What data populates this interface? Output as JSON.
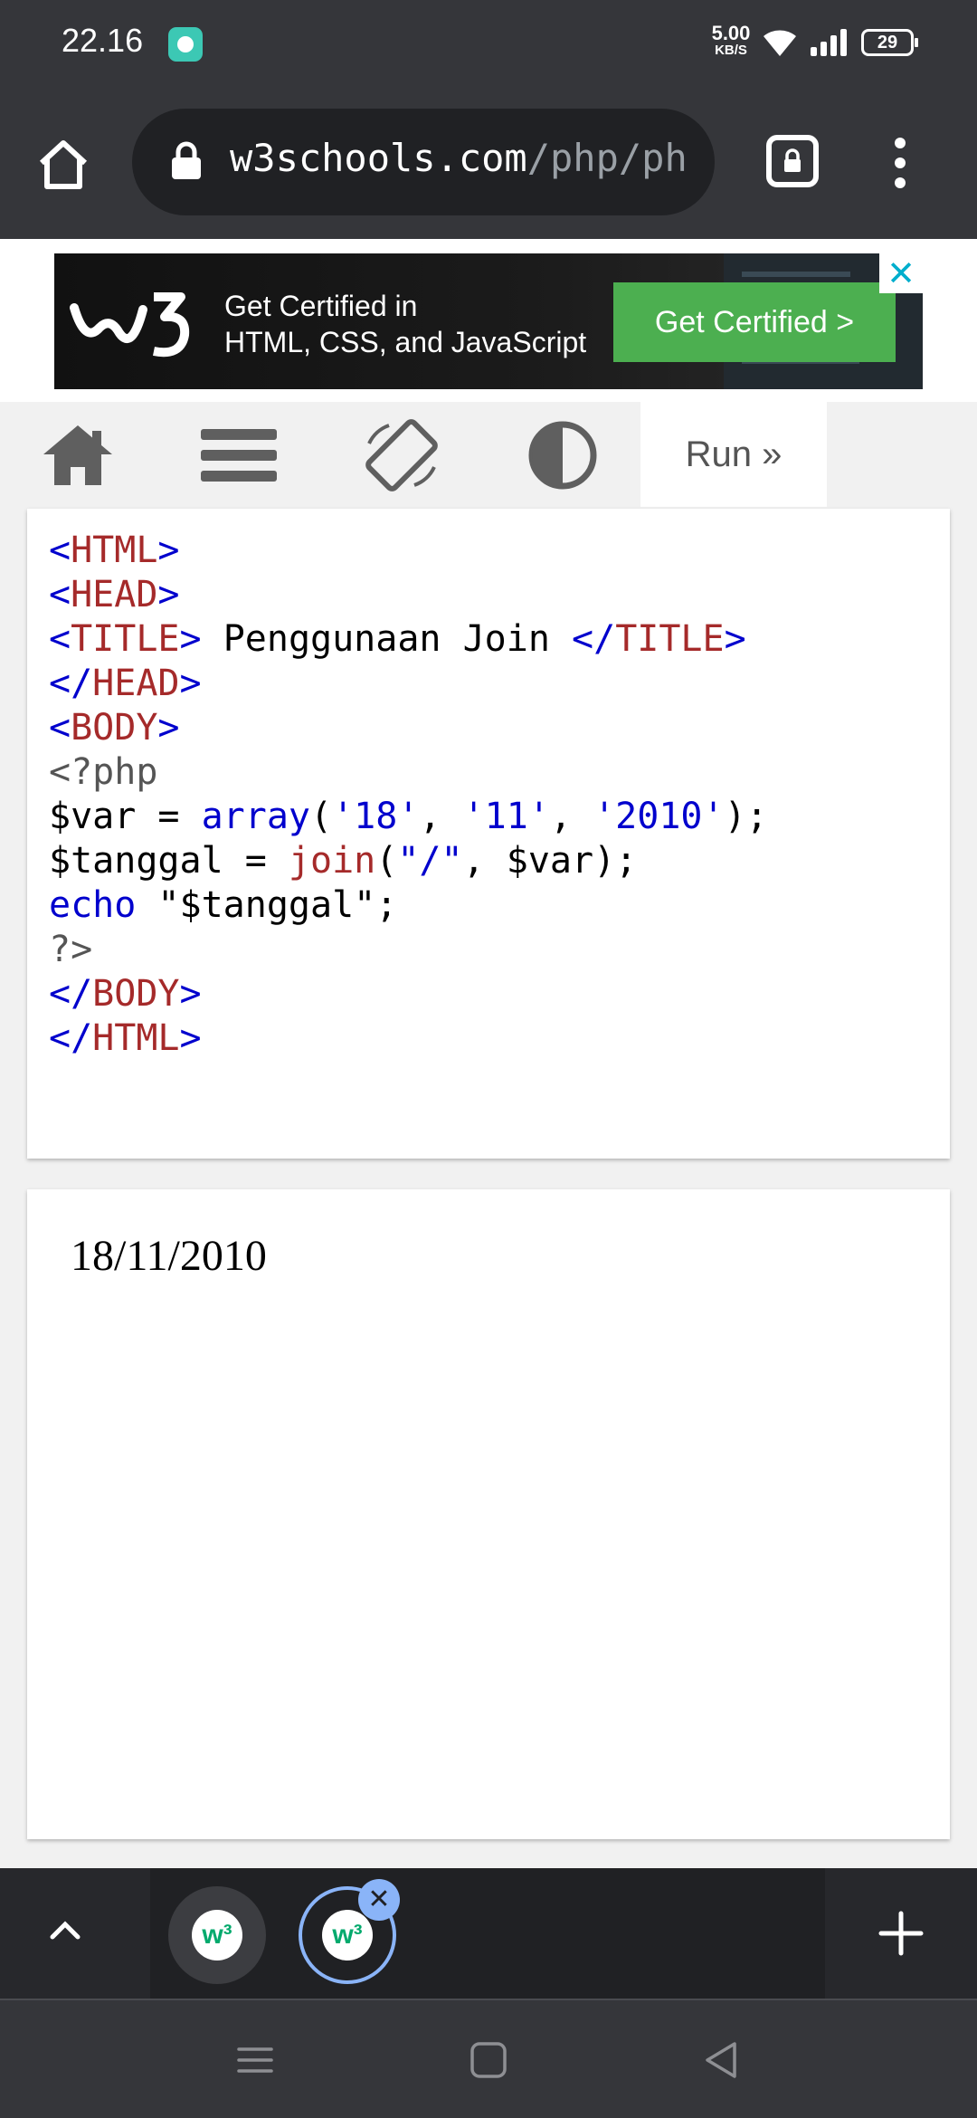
{
  "status_bar": {
    "time": "22.16",
    "net_speed_value": "5.00",
    "net_speed_unit": "KB/S",
    "battery_level": "29"
  },
  "browser": {
    "url_host": "w3schools.com",
    "url_path": "/php/ph"
  },
  "ad": {
    "line1": "Get Certified in",
    "line2": "HTML, CSS, and JavaScript",
    "button_label": "Get Certified >",
    "close_label": "✕"
  },
  "editor_toolbar": {
    "run_label": "Run »"
  },
  "code_lines": [
    [
      {
        "t": "<",
        "c": "bl"
      },
      {
        "t": "HTML",
        "c": "br"
      },
      {
        "t": ">",
        "c": "bl"
      }
    ],
    [
      {
        "t": "<",
        "c": "bl"
      },
      {
        "t": "HEAD",
        "c": "br"
      },
      {
        "t": ">",
        "c": "bl"
      }
    ],
    [
      {
        "t": "<",
        "c": "bl"
      },
      {
        "t": "TITLE",
        "c": "br"
      },
      {
        "t": ">",
        "c": "bl"
      },
      {
        "t": " Penggunaan Join ",
        "c": ""
      },
      {
        "t": "</",
        "c": "bl"
      },
      {
        "t": "TITLE",
        "c": "br"
      },
      {
        "t": ">",
        "c": "bl"
      }
    ],
    [
      {
        "t": "</",
        "c": "bl"
      },
      {
        "t": "HEAD",
        "c": "br"
      },
      {
        "t": ">",
        "c": "bl"
      }
    ],
    [
      {
        "t": "<",
        "c": "bl"
      },
      {
        "t": "BODY",
        "c": "br"
      },
      {
        "t": ">",
        "c": "bl"
      }
    ],
    [
      {
        "t": "<?php",
        "c": "gr"
      }
    ],
    [
      {
        "t": "$var = ",
        "c": ""
      },
      {
        "t": "array",
        "c": "bl"
      },
      {
        "t": "(",
        "c": ""
      },
      {
        "t": "'18'",
        "c": "bl"
      },
      {
        "t": ", ",
        "c": ""
      },
      {
        "t": "'11'",
        "c": "bl"
      },
      {
        "t": ", ",
        "c": ""
      },
      {
        "t": "'2010'",
        "c": "bl"
      },
      {
        "t": ");",
        "c": ""
      }
    ],
    [
      {
        "t": "$tanggal = ",
        "c": ""
      },
      {
        "t": "join",
        "c": "br"
      },
      {
        "t": "(",
        "c": ""
      },
      {
        "t": "\"/\"",
        "c": "bl"
      },
      {
        "t": ", $var);",
        "c": ""
      }
    ],
    [
      {
        "t": "echo",
        "c": "bl"
      },
      {
        "t": " ",
        "c": ""
      },
      {
        "t": "\"$tanggal\"",
        "c": ""
      },
      {
        "t": ";",
        "c": ""
      }
    ],
    [
      {
        "t": "?>",
        "c": "gr"
      }
    ],
    [
      {
        "t": "</",
        "c": "bl"
      },
      {
        "t": "BODY",
        "c": "br"
      },
      {
        "t": ">",
        "c": "bl"
      }
    ],
    [
      {
        "t": "</",
        "c": "bl"
      },
      {
        "t": "HTML",
        "c": "br"
      },
      {
        "t": ">",
        "c": "bl"
      }
    ]
  ],
  "result": {
    "output": "18/11/2010"
  },
  "tab_switcher": {
    "close_label": "✕"
  },
  "colors": {
    "chrome_dark": "#35363a",
    "omnibox": "#202124",
    "w3_green": "#04aa6d",
    "ad_button_green": "#4caf50",
    "code_blue": "#0000cd",
    "code_brown": "#a52a2a",
    "active_tab_ring": "#8ab4f8"
  }
}
